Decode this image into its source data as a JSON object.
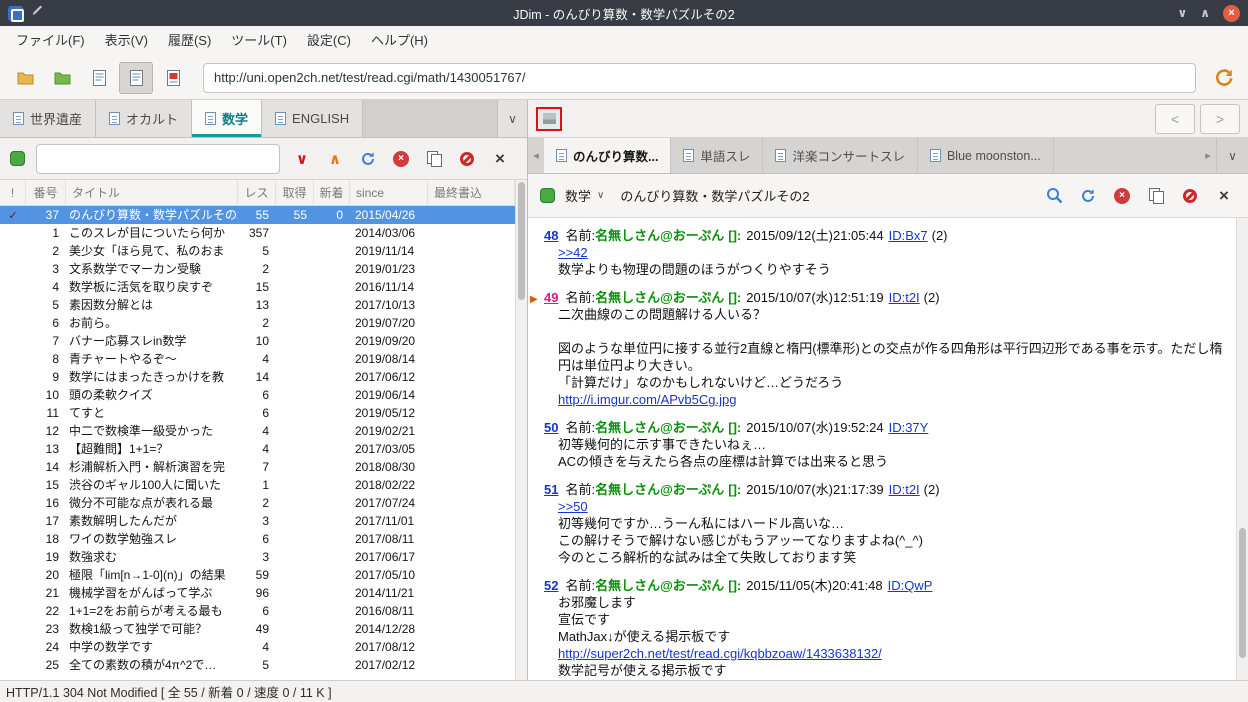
{
  "glyphs": {
    "check": "✓",
    "chevron_down": "∨",
    "chevron_up": "∧",
    "close": "×",
    "nav_prev": "<",
    "nav_next": ">",
    "tab_scroll_left": "◂",
    "tab_scroll_right": "▸",
    "post_marker": "▶"
  },
  "titlebar": {
    "title": "JDim - のんびり算数・数学パズルその2"
  },
  "menubar": {
    "items": [
      {
        "label": "ファイル(F)",
        "slug": "file"
      },
      {
        "label": "表示(V)",
        "slug": "view"
      },
      {
        "label": "履歴(S)",
        "slug": "history"
      },
      {
        "label": "ツール(T)",
        "slug": "tools"
      },
      {
        "label": "設定(C)",
        "slug": "settings"
      },
      {
        "label": "ヘルプ(H)",
        "slug": "help"
      }
    ]
  },
  "main_toolbar": {
    "url": "http://uni.open2ch.net/test/read.cgi/math/1430051767/"
  },
  "board_tabbar": {
    "tabs": [
      {
        "label": "世界遺産",
        "slug": "world-heritage",
        "active": false
      },
      {
        "label": "オカルト",
        "slug": "occult",
        "active": false
      },
      {
        "label": "数学",
        "slug": "math",
        "active": true
      },
      {
        "label": "ENGLISH",
        "slug": "english",
        "active": false
      }
    ]
  },
  "board_list": {
    "columns": [
      "!",
      "番号",
      "タイトル",
      "レス",
      "取得",
      "新着",
      "since",
      "最終書込"
    ],
    "rows": [
      {
        "mark": "check",
        "num": "37",
        "title": "のんびり算数・数学パズルその2",
        "res": "55",
        "got": "55",
        "new": "0",
        "since": "2015/04/26",
        "selected": true
      },
      {
        "num": "1",
        "title": "このスレが目についたら何か",
        "res": "357",
        "since": "2014/03/06"
      },
      {
        "num": "2",
        "title": "美少女「ほら見て、私のおま",
        "res": "5",
        "since": "2019/11/14"
      },
      {
        "num": "3",
        "title": "文系数学でマーカン受験",
        "res": "2",
        "since": "2019/01/23"
      },
      {
        "num": "4",
        "title": "数学板に活気を取り戻すぞ",
        "res": "15",
        "since": "2016/11/14"
      },
      {
        "num": "5",
        "title": "素因数分解とは",
        "res": "13",
        "since": "2017/10/13"
      },
      {
        "num": "6",
        "title": "お前ら。",
        "res": "2",
        "since": "2019/07/20"
      },
      {
        "num": "7",
        "title": "バナー応募スレin数学",
        "res": "10",
        "since": "2019/09/20"
      },
      {
        "num": "8",
        "title": "青チャートやるぞ〜",
        "res": "4",
        "since": "2019/08/14"
      },
      {
        "num": "9",
        "title": "数学にはまったきっかけを教",
        "res": "14",
        "since": "2017/06/12"
      },
      {
        "num": "10",
        "title": "頭の柔軟クイズ",
        "res": "6",
        "since": "2019/06/14"
      },
      {
        "num": "11",
        "title": "てすと",
        "res": "6",
        "since": "2019/05/12"
      },
      {
        "num": "12",
        "title": "中二で数検準一級受かった",
        "res": "4",
        "since": "2019/02/21"
      },
      {
        "num": "13",
        "title": "【超難問】1+1=？",
        "res": "4",
        "since": "2017/03/05"
      },
      {
        "num": "14",
        "title": "杉浦解析入門・解析演習を完",
        "res": "7",
        "since": "2018/08/30"
      },
      {
        "num": "15",
        "title": "渋谷のギャル100人に聞いた",
        "res": "1",
        "since": "2018/02/22"
      },
      {
        "num": "16",
        "title": "微分不可能な点が表れる最",
        "res": "2",
        "since": "2017/07/24"
      },
      {
        "num": "17",
        "title": "素数解明したんだが",
        "res": "3",
        "since": "2017/11/01"
      },
      {
        "num": "18",
        "title": "ワイの数学勉強スレ",
        "res": "6",
        "since": "2017/08/11"
      },
      {
        "num": "19",
        "title": "数強求む",
        "res": "3",
        "since": "2017/06/17"
      },
      {
        "num": "20",
        "title": "極限「lim[n→1-0](n)」の結果",
        "res": "59",
        "since": "2017/05/10"
      },
      {
        "num": "21",
        "title": "機械学習をがんばって学ぶ",
        "res": "96",
        "since": "2014/11/21"
      },
      {
        "num": "22",
        "title": "1+1=2をお前らが考える最も",
        "res": "6",
        "since": "2016/08/11"
      },
      {
        "num": "23",
        "title": "数検1級って独学で可能？",
        "res": "49",
        "since": "2014/12/28"
      },
      {
        "num": "24",
        "title": "中学の数学です",
        "res": "4",
        "since": "2017/08/12"
      },
      {
        "num": "25",
        "title": "全ての素数の積が4π^2で…",
        "res": "5",
        "since": "2017/02/12"
      }
    ]
  },
  "thread_nav": {
    "prev": "<",
    "next": ">"
  },
  "thread_tabbar": {
    "tabs": [
      {
        "label": "のんびり算数...",
        "slug": "nonbiri-math",
        "active": true
      },
      {
        "label": "単語スレ",
        "slug": "tango",
        "active": false
      },
      {
        "label": "洋楽コンサートスレ",
        "slug": "yogaku-concert",
        "active": false
      },
      {
        "label": "Blue moonston...",
        "slug": "blue-moonstone",
        "active": false
      }
    ]
  },
  "thread_toolbar": {
    "board": "数学",
    "title": "のんびり算数・数学パズルその2"
  },
  "thread": {
    "name_label": "名前:",
    "name": "名無しさん@おーぷん",
    "posts": [
      {
        "num": "48",
        "read": false,
        "marker": false,
        "mail": "[]:",
        "date": "2015/09/12(土)21:05:44",
        "id": "ID:Bx7",
        "count": "(2)",
        "lines": [
          {
            "type": "link",
            "text": ">>42"
          },
          {
            "type": "text",
            "text": "数学よりも物理の問題のほうがつくりやすそう"
          }
        ]
      },
      {
        "num": "49",
        "read": true,
        "marker": true,
        "mail": "[]:",
        "date": "2015/10/07(水)12:51:19",
        "id": "ID:t2I",
        "count": "(2)",
        "lines": [
          {
            "type": "text",
            "text": "二次曲線のこの問題解ける人いる？"
          },
          {
            "type": "text",
            "text": ""
          },
          {
            "type": "text",
            "text": "図のような単位円に接する並行2直線と楕円(標準形)との交点が作る四角形は平行四辺形である事を示す。ただし楕円は単位円より大きい。"
          },
          {
            "type": "text",
            "text": "「計算だけ」なのかもしれないけど…どうだろう"
          },
          {
            "type": "link",
            "text": "http://i.imgur.com/APvb5Cg.jpg"
          }
        ]
      },
      {
        "num": "50",
        "read": false,
        "marker": false,
        "mail": "[]:",
        "date": "2015/10/07(水)19:52:24",
        "id": "ID:37Y",
        "count": "",
        "lines": [
          {
            "type": "text",
            "text": "初等幾何的に示す事できたいねぇ…"
          },
          {
            "type": "text",
            "text": "ACの傾きを与えたら各点の座標は計算では出来ると思う"
          }
        ]
      },
      {
        "num": "51",
        "read": false,
        "marker": false,
        "mail": "[]:",
        "date": "2015/10/07(水)21:17:39",
        "id": "ID:t2I",
        "count": "(2)",
        "lines": [
          {
            "type": "link",
            "text": ">>50"
          },
          {
            "type": "text",
            "text": "初等幾何ですか…うーん私にはハードル高いな…"
          },
          {
            "type": "text",
            "text": "この解けそうで解けない感じがもうアッーてなりますよね(^_^)"
          },
          {
            "type": "text",
            "text": "今のところ解析的な試みは全て失敗しております笑"
          }
        ]
      },
      {
        "num": "52",
        "read": false,
        "marker": false,
        "mail": "[]:",
        "date": "2015/11/05(木)20:41:48",
        "id": "ID:QwP",
        "count": "",
        "lines": [
          {
            "type": "text",
            "text": "お邪魔します"
          },
          {
            "type": "text",
            "text": "宣伝です"
          },
          {
            "type": "text",
            "text": "MathJax↓が使える掲示板です"
          },
          {
            "type": "link",
            "text": "http://super2ch.net/test/read.cgi/kqbbzoaw/1433638132/"
          },
          {
            "type": "text",
            "text": "数学記号が使える掲示板です"
          }
        ]
      }
    ]
  },
  "statusbar": {
    "text": "HTTP/1.1 304 Not Modified [ 全 55 / 新着 0 / 速度 0 / 11 K ]"
  }
}
